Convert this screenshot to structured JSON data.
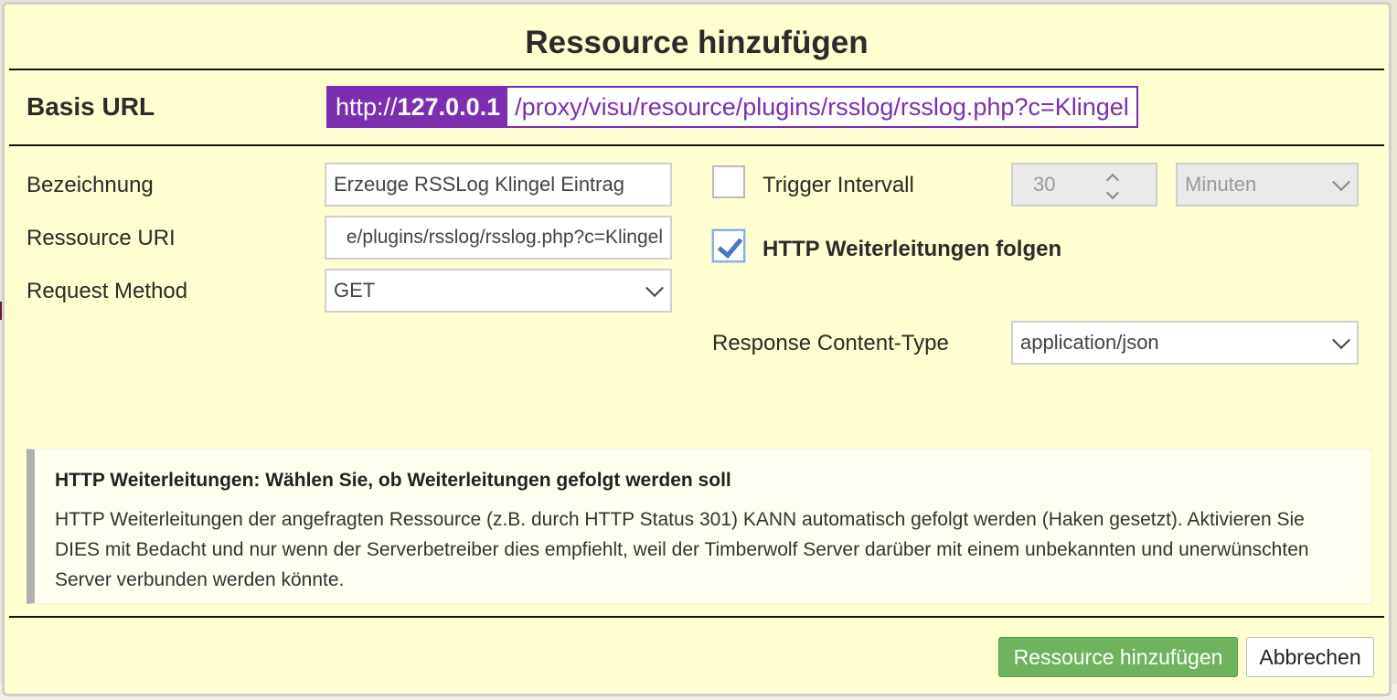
{
  "dialog": {
    "title": "Ressource hinzufügen",
    "base_url": {
      "label": "Basis URL",
      "scheme": "http://",
      "host": "127.0.0.1",
      "path": "/proxy/visu/resource/plugins/rsslog/rsslog.php?c=Klingel"
    },
    "form": {
      "bezeichnung": {
        "label": "Bezeichnung",
        "value": "Erzeuge RSSLog Klingel Eintrag"
      },
      "ressource_uri": {
        "label": "Ressource URI",
        "value": "e/plugins/rsslog/rsslog.php?c=Klingel"
      },
      "request_method": {
        "label": "Request Method",
        "value": "GET"
      },
      "trigger": {
        "label": "Trigger Intervall",
        "checked": false,
        "value": "30",
        "unit": "Minuten"
      },
      "http_redirect": {
        "label": "HTTP Weiterleitungen folgen",
        "checked": true
      },
      "response_content_type": {
        "label": "Response Content-Type",
        "value": "application/json"
      }
    },
    "help": {
      "heading": "HTTP Weiterleitungen: Wählen Sie, ob Weiterleitungen gefolgt werden soll",
      "text": "HTTP Weiterleitungen der angefragten Ressource (z.B. durch HTTP Status 301) KANN automatisch gefolgt werden (Haken gesetzt). Aktivieren Sie DIES mit Bedacht und nur wenn der Serverbetreiber dies empfiehlt, weil der Timberwolf Server darüber mit einem unbekannten und unerwünschten Server verbunden werden könnte."
    },
    "buttons": {
      "submit": "Ressource hinzufügen",
      "cancel": "Abbrechen"
    }
  },
  "colors": {
    "dialog_bg": "#fefed0",
    "accent_purple": "#7b2fb0",
    "primary_green": "#6fb35f",
    "checkbox_blue": "#4a78c0"
  }
}
